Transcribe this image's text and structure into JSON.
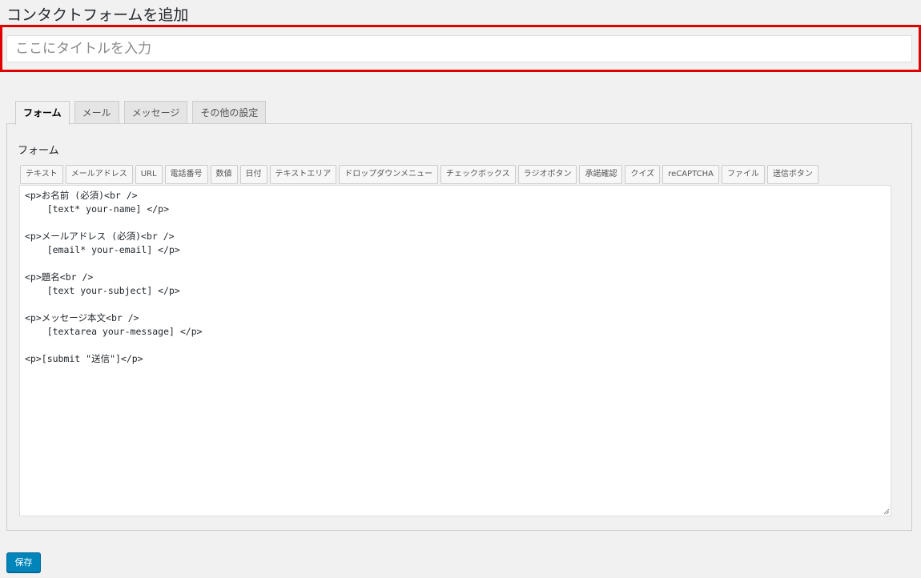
{
  "header": {
    "title": "コンタクトフォームを追加"
  },
  "title_field": {
    "value": "",
    "placeholder": "ここにタイトルを入力"
  },
  "tabs": [
    {
      "label": "フォーム",
      "active": true
    },
    {
      "label": "メール",
      "active": false
    },
    {
      "label": "メッセージ",
      "active": false
    },
    {
      "label": "その他の設定",
      "active": false
    }
  ],
  "form_panel": {
    "heading": "フォーム",
    "tag_buttons": [
      "テキスト",
      "メールアドレス",
      "URL",
      "電話番号",
      "数値",
      "日付",
      "テキストエリア",
      "ドロップダウンメニュー",
      "チェックボックス",
      "ラジオボタン",
      "承諾確認",
      "クイズ",
      "reCAPTCHA",
      "ファイル",
      "送信ボタン"
    ],
    "editor_content": "<p>お名前 (必須)<br />\n    [text* your-name] </p>\n\n<p>メールアドレス (必須)<br />\n    [email* your-email] </p>\n\n<p>題名<br />\n    [text your-subject] </p>\n\n<p>メッセージ本文<br />\n    [textarea your-message] </p>\n\n<p>[submit \"送信\"]</p>"
  },
  "actions": {
    "save_label": "保存"
  },
  "colors": {
    "highlight": "#e00000",
    "primary_button": "#0085ba"
  }
}
